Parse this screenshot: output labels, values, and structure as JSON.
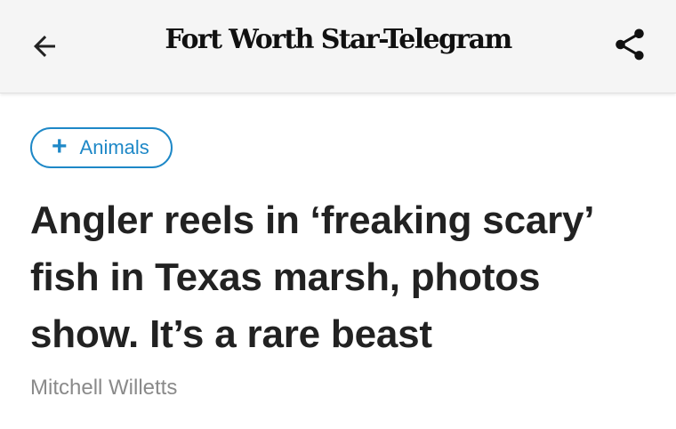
{
  "header": {
    "brand": "Fort Worth Star-Telegram",
    "back_icon": "arrow-left-icon",
    "share_icon": "share-icon"
  },
  "article": {
    "topic": {
      "icon": "plus-icon",
      "plus_glyph": "+",
      "label": "Animals"
    },
    "headline": "Angler reels in ‘freaking scary’ fish in Texas marsh, photos show. It’s a rare beast",
    "byline": "Mitchell Willetts"
  },
  "colors": {
    "accent": "#1e88c7",
    "topbar_bg": "#f5f5f5",
    "headline": "#222222",
    "byline": "#8a8a8a"
  }
}
